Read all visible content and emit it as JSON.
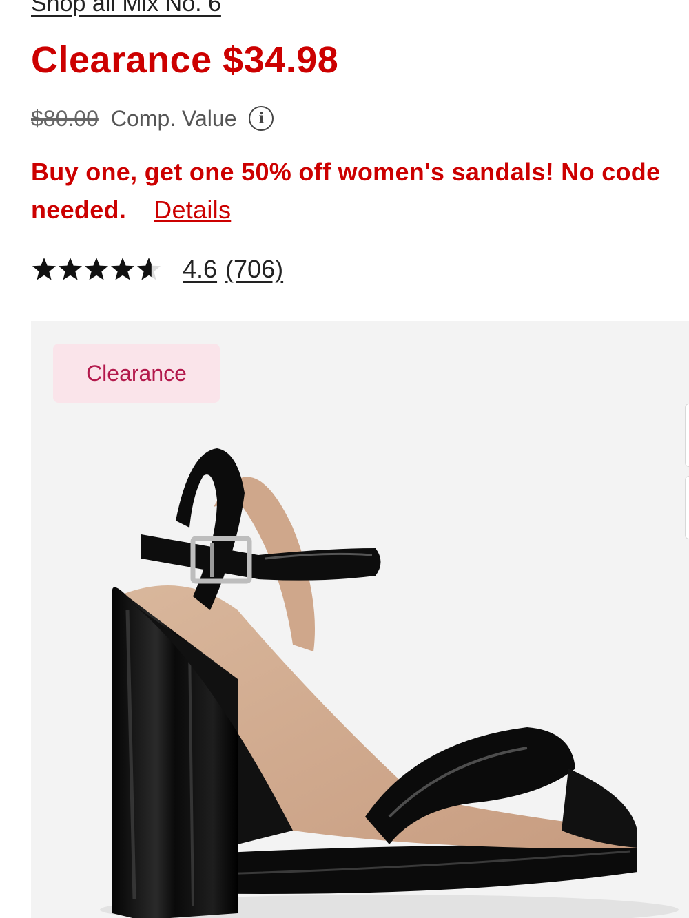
{
  "product": {
    "shop_all_link": "Shop all Mix No. 6",
    "price_label": "Clearance $34.98",
    "comp_value_price": "$80.00",
    "comp_value_label": "Comp. Value",
    "info_icon": "info-icon",
    "promo_text": "Buy one, get one 50% off women's sandals! No code needed.",
    "promo_details_link": "Details",
    "rating_value": "4.6",
    "rating_count": "(706)",
    "rating_stars": 4.6,
    "rating_max": 5,
    "image_badge": "Clearance"
  },
  "colors": {
    "accent_red": "#cc0000",
    "badge_bg": "#fae4ea",
    "badge_text": "#b3194c",
    "image_bg": "#f3f3f3"
  }
}
